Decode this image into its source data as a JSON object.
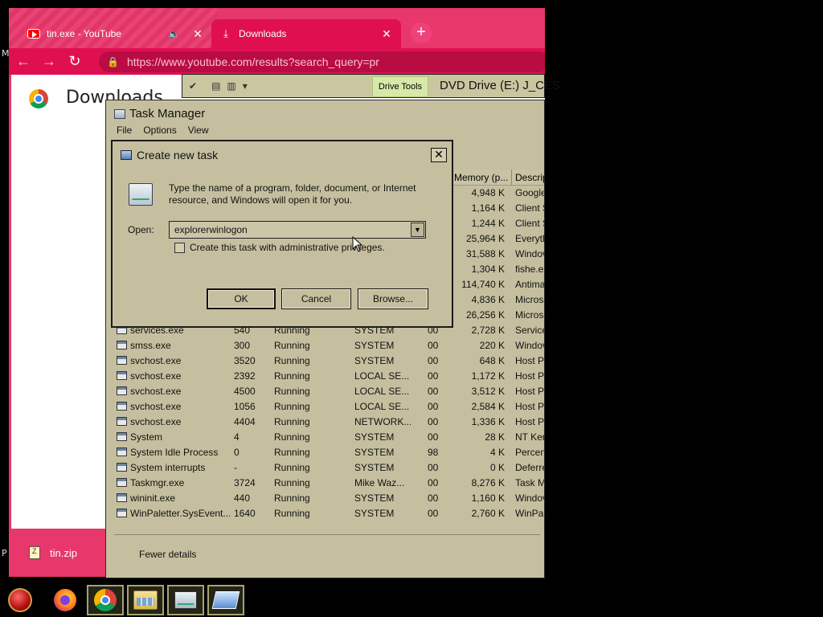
{
  "chrome": {
    "tabs": [
      {
        "label": "tin.exe - YouTube",
        "close": "✕",
        "speaker": "🔈"
      },
      {
        "label": "Downloads",
        "close": "✕"
      }
    ],
    "new_tab": "+",
    "url_host": "https://www.youtube.com",
    "url_path": "/results?search_query=pr",
    "page_heading": "Downloads",
    "download_file": "tin.zip"
  },
  "explorer": {
    "context_tab": "Drive Tools",
    "title": "DVD Drive (E:) J_CES"
  },
  "taskmgr": {
    "title": "Task Manager",
    "menu": [
      "File",
      "Options",
      "View"
    ],
    "columns": {
      "memory": "Memory (p...",
      "description": "Descrip"
    },
    "upper_rows": [
      {
        "memory": "4,948 K",
        "desc": "Google"
      },
      {
        "memory": "1,164 K",
        "desc": "Client S"
      },
      {
        "memory": "1,244 K",
        "desc": "Client S"
      },
      {
        "memory": "25,964 K",
        "desc": "Everyth"
      },
      {
        "memory": "31,588 K",
        "desc": "Windov"
      },
      {
        "memory": "1,304 K",
        "desc": "fishe.ex"
      },
      {
        "memory": "114,740 K",
        "desc": "Antima"
      },
      {
        "memory": "4,836 K",
        "desc": "Microsc"
      },
      {
        "memory": "26,256 K",
        "desc": "Microsc"
      }
    ],
    "rows": [
      {
        "name": "services.exe",
        "pid": "540",
        "status": "Running",
        "user": "SYSTEM",
        "cpu": "00",
        "memory": "2,728 K",
        "desc": "Service"
      },
      {
        "name": "smss.exe",
        "pid": "300",
        "status": "Running",
        "user": "SYSTEM",
        "cpu": "00",
        "memory": "220 K",
        "desc": "Windov"
      },
      {
        "name": "svchost.exe",
        "pid": "3520",
        "status": "Running",
        "user": "SYSTEM",
        "cpu": "00",
        "memory": "648 K",
        "desc": "Host Pr"
      },
      {
        "name": "svchost.exe",
        "pid": "2392",
        "status": "Running",
        "user": "LOCAL SE...",
        "cpu": "00",
        "memory": "1,172 K",
        "desc": "Host Pr"
      },
      {
        "name": "svchost.exe",
        "pid": "4500",
        "status": "Running",
        "user": "LOCAL SE...",
        "cpu": "00",
        "memory": "3,512 K",
        "desc": "Host Pr"
      },
      {
        "name": "svchost.exe",
        "pid": "1056",
        "status": "Running",
        "user": "LOCAL SE...",
        "cpu": "00",
        "memory": "2,584 K",
        "desc": "Host Pr"
      },
      {
        "name": "svchost.exe",
        "pid": "4404",
        "status": "Running",
        "user": "NETWORK...",
        "cpu": "00",
        "memory": "1,336 K",
        "desc": "Host Pr"
      },
      {
        "name": "System",
        "pid": "4",
        "status": "Running",
        "user": "SYSTEM",
        "cpu": "00",
        "memory": "28 K",
        "desc": "NT Kern"
      },
      {
        "name": "System Idle Process",
        "pid": "0",
        "status": "Running",
        "user": "SYSTEM",
        "cpu": "98",
        "memory": "4 K",
        "desc": "Percent"
      },
      {
        "name": "System interrupts",
        "pid": "-",
        "status": "Running",
        "user": "SYSTEM",
        "cpu": "00",
        "memory": "0 K",
        "desc": "Deferre"
      },
      {
        "name": "Taskmgr.exe",
        "pid": "3724",
        "status": "Running",
        "user": "Mike Waz...",
        "cpu": "00",
        "memory": "8,276 K",
        "desc": "Task M"
      },
      {
        "name": "wininit.exe",
        "pid": "440",
        "status": "Running",
        "user": "SYSTEM",
        "cpu": "00",
        "memory": "1,160 K",
        "desc": "Windov"
      },
      {
        "name": "WinPaletter.SysEvent...",
        "pid": "1640",
        "status": "Running",
        "user": "SYSTEM",
        "cpu": "00",
        "memory": "2,760 K",
        "desc": "WinPal"
      }
    ],
    "fewer_details": "Fewer details"
  },
  "dialog": {
    "title": "Create new task",
    "close": "✕",
    "description": "Type the name of a program, folder, document, or Internet resource, and Windows will open it for you.",
    "open_label": "Open:",
    "open_value": "explorerwinlogon",
    "dropdown_arrow": "▼",
    "admin_label": "Create this task with administrative privileges.",
    "admin_checked": false,
    "ok": "OK",
    "cancel": "Cancel",
    "browse": "Browse..."
  },
  "taskbar": {
    "items": [
      "start-orb",
      "firefox",
      "chrome",
      "file-explorer",
      "task-manager",
      "run-dialog"
    ]
  },
  "colors": {
    "chrome_accent": "#e01050",
    "window_bg": "#c6bf9f",
    "drive_tools": "#d7e8a9"
  }
}
